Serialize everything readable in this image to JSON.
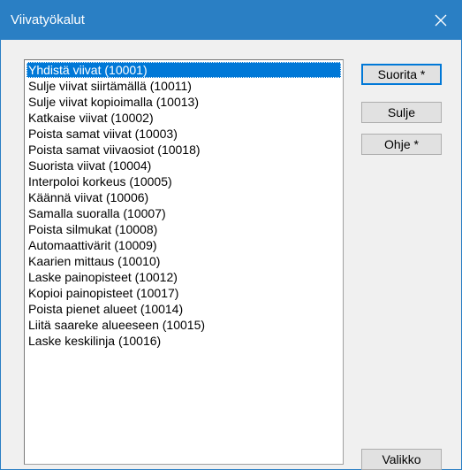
{
  "window": {
    "title": "Viivatyökalut",
    "accent_color": "#2a7fc4"
  },
  "titlebar": {
    "close_icon": "close-icon"
  },
  "list": {
    "selected_index": 0,
    "items": [
      "Yhdistä viivat  (10001)",
      "Sulje viivat siirtämällä  (10011)",
      "Sulje viivat kopioimalla  (10013)",
      "Katkaise viivat  (10002)",
      "Poista samat viivat  (10003)",
      "Poista samat viivaosiot  (10018)",
      "Suorista viivat  (10004)",
      "Interpoloi korkeus  (10005)",
      "Käännä viivat  (10006)",
      "Samalla suoralla  (10007)",
      "Poista silmukat  (10008)",
      "Automaattivärit  (10009)",
      "Kaarien mittaus  (10010)",
      "Laske painopisteet  (10012)",
      "Kopioi painopisteet  (10017)",
      "Poista pienet alueet  (10014)",
      "Liitä saareke alueeseen  (10015)",
      "Laske keskilinja  (10016)"
    ]
  },
  "buttons": {
    "run": "Suorita *",
    "close": "Sulje",
    "help": "Ohje *",
    "menu": "Valikko"
  }
}
